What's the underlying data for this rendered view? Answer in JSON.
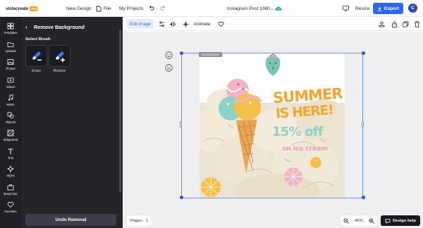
{
  "app": {
    "logo_text": "vistacreate",
    "pro_badge": "Pro",
    "new_design": "New Design",
    "file_menu": "File",
    "my_projects": "My Projects",
    "doc_title": "Instagram Post 1080...",
    "resize": "Resize",
    "export": "Export",
    "avatar_initial": "C"
  },
  "rail": [
    {
      "label": "Templates",
      "icon": "templates-icon"
    },
    {
      "label": "Uploads",
      "icon": "folder-icon"
    },
    {
      "label": "Photos",
      "icon": "photo-icon"
    },
    {
      "label": "Videos",
      "icon": "video-icon"
    },
    {
      "label": "Music",
      "icon": "music-icon"
    },
    {
      "label": "Objects",
      "icon": "objects-icon"
    },
    {
      "label": "Bckground",
      "icon": "background-icon"
    },
    {
      "label": "Text",
      "icon": "text-icon"
    },
    {
      "label": "Styles",
      "icon": "styles-icon"
    },
    {
      "label": "Brand Kits",
      "icon": "brand-kit-icon"
    },
    {
      "label": "Favorites",
      "icon": "heart-icon"
    }
  ],
  "panel": {
    "title": "Remove Background",
    "select_brush": "Select Brush",
    "erase": "Erase",
    "restore": "Restore",
    "undo_removal": "Undo Removal"
  },
  "toolbar": {
    "edit_image": "Edit Image",
    "animate": "Animate"
  },
  "canvas": {
    "background_tag": "Background",
    "pages": "Pages - 1",
    "zoom": "45%",
    "design_help": "Design help",
    "headline_1": "SUMMER",
    "headline_2": "IS HERE!",
    "discount": "15% off",
    "product": "on ice cream"
  },
  "colors": {
    "accent": "#2f66e5",
    "panel_bg": "#24242b",
    "rail_bg": "#202026",
    "canvas_bg": "#efeff1",
    "headline": "#f4a532",
    "discount": "#8fd0c6",
    "product": "#f29bb8"
  }
}
